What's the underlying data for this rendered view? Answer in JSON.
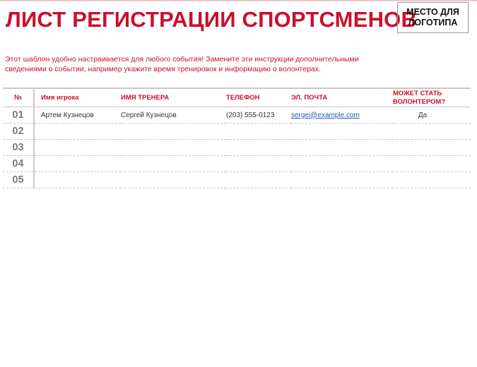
{
  "title": "ЛИСТ РЕГИСТРАЦИИ СПОРТСМЕНОВ",
  "logo_placeholder": "МЕСТО ДЛЯ\nЛОГОТИПА",
  "instructions": "Этот шаблон удобно настраивается для любого события! Замените эти инструкции дополнительными сведениями о событии, например укажите время тренировок и информацию о волонтерах.",
  "colors": {
    "accent": "#c8102e",
    "link": "#1f5fa8",
    "rule": "#c8c8c8"
  },
  "table": {
    "headers": {
      "num": "№",
      "player": "Имя игрока",
      "coach": "ИМЯ ТРЕНЕРА",
      "phone": "ТЕЛЕФОН",
      "email": "ЭЛ. ПОЧТА",
      "volunteer": "МОЖЕТ СТАТЬ ВОЛОНТЕРОМ?"
    },
    "rows": [
      {
        "num": "01",
        "player": "Артем Кузнецов",
        "coach": "Сергей Кузнецов",
        "phone": "(203) 555-0123",
        "email": "sergei@example.com",
        "volunteer": "Да"
      },
      {
        "num": "02",
        "player": "",
        "coach": "",
        "phone": "",
        "email": "",
        "volunteer": ""
      },
      {
        "num": "03",
        "player": "",
        "coach": "",
        "phone": "",
        "email": "",
        "volunteer": ""
      },
      {
        "num": "04",
        "player": "",
        "coach": "",
        "phone": "",
        "email": "",
        "volunteer": ""
      },
      {
        "num": "05",
        "player": "",
        "coach": "",
        "phone": "",
        "email": "",
        "volunteer": ""
      }
    ]
  }
}
